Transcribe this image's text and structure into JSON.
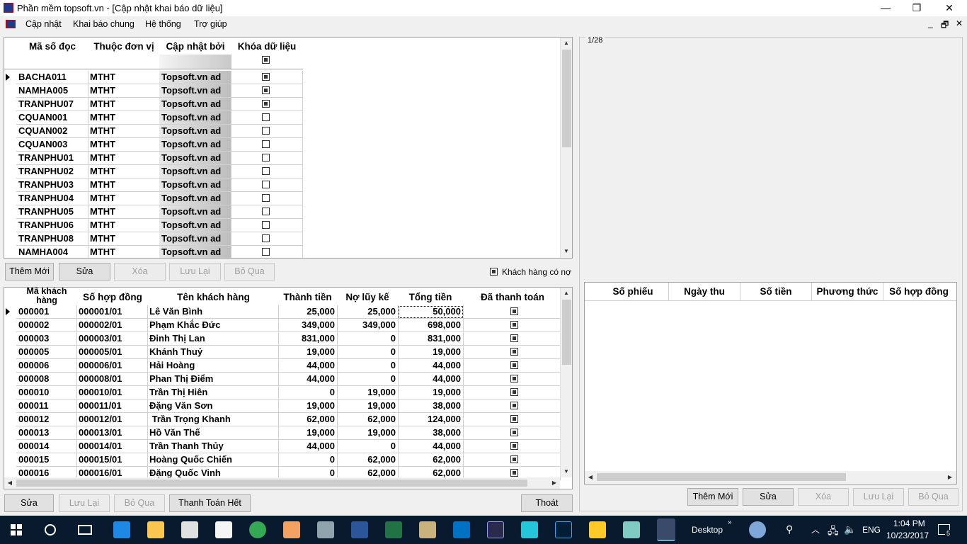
{
  "window": {
    "title": "Phần mềm topsoft.vn - [Cập nhật khai báo dữ liệu]",
    "controls": [
      "—",
      "❐",
      "✕"
    ]
  },
  "menu": {
    "items": [
      "Cập nhật",
      "Khai báo chung",
      "Hệ thống",
      "Trợ giúp"
    ],
    "mdi_controls": [
      "_",
      "🗗",
      "✕"
    ]
  },
  "readers_grid": {
    "columns": [
      "Mã số đọc",
      "Thuộc đơn vị",
      "Cập nhật bởi",
      "Khóa dữ liệu"
    ],
    "header_lock_checked": true,
    "rows": [
      {
        "code": "BACHA011",
        "unit": "MTHT",
        "by": "Topsoft.vn ad",
        "locked": true
      },
      {
        "code": "NAMHA005",
        "unit": "MTHT",
        "by": "Topsoft.vn ad",
        "locked": true
      },
      {
        "code": "TRANPHU07",
        "unit": "MTHT",
        "by": "Topsoft.vn ad",
        "locked": true
      },
      {
        "code": "CQUAN001",
        "unit": "MTHT",
        "by": "Topsoft.vn ad",
        "locked": false
      },
      {
        "code": "CQUAN002",
        "unit": "MTHT",
        "by": "Topsoft.vn ad",
        "locked": false
      },
      {
        "code": "CQUAN003",
        "unit": "MTHT",
        "by": "Topsoft.vn ad",
        "locked": false
      },
      {
        "code": "TRANPHU01",
        "unit": "MTHT",
        "by": "Topsoft.vn ad",
        "locked": false
      },
      {
        "code": "TRANPHU02",
        "unit": "MTHT",
        "by": "Topsoft.vn ad",
        "locked": false
      },
      {
        "code": "TRANPHU03",
        "unit": "MTHT",
        "by": "Topsoft.vn ad",
        "locked": false
      },
      {
        "code": "TRANPHU04",
        "unit": "MTHT",
        "by": "Topsoft.vn ad",
        "locked": false
      },
      {
        "code": "TRANPHU05",
        "unit": "MTHT",
        "by": "Topsoft.vn ad",
        "locked": false
      },
      {
        "code": "TRANPHU06",
        "unit": "MTHT",
        "by": "Topsoft.vn ad",
        "locked": false
      },
      {
        "code": "TRANPHU08",
        "unit": "MTHT",
        "by": "Topsoft.vn ad",
        "locked": false
      },
      {
        "code": "NAMHA004",
        "unit": "MTHT",
        "by": "Topsoft.vn ad",
        "locked": false
      }
    ]
  },
  "top_buttons": {
    "add": "Thêm Mới",
    "edit": "Sửa",
    "delete": "Xóa",
    "save": "Lưu Lại",
    "cancel": "Bỏ Qua"
  },
  "debt_filter": {
    "label": "Khách hàng có nợ",
    "checked": true
  },
  "customers_grid": {
    "columns": [
      "Mã khách hàng",
      "Số hợp đồng",
      "Tên khách hàng",
      "Thành tiền",
      "Nợ lũy kế",
      "Tổng tiền",
      "Đã thanh toán"
    ],
    "rows": [
      {
        "id": "000001",
        "contract": "000001/01",
        "name": "Lê Văn Bình",
        "amount": "25,000",
        "debt": "25,000",
        "total": "50,000",
        "paid": true
      },
      {
        "id": "000002",
        "contract": "000002/01",
        "name": "Phạm Khắc Đức",
        "amount": "349,000",
        "debt": "349,000",
        "total": "698,000",
        "paid": true
      },
      {
        "id": "000003",
        "contract": "000003/01",
        "name": "Đinh Thị Lan",
        "amount": "831,000",
        "debt": "0",
        "total": "831,000",
        "paid": true
      },
      {
        "id": "000005",
        "contract": "000005/01",
        "name": "Khánh Thuỷ",
        "amount": "19,000",
        "debt": "0",
        "total": "19,000",
        "paid": true
      },
      {
        "id": "000006",
        "contract": "000006/01",
        "name": "Hải Hoàng",
        "amount": "44,000",
        "debt": "0",
        "total": "44,000",
        "paid": true
      },
      {
        "id": "000008",
        "contract": "000008/01",
        "name": "Phan Thị Điểm",
        "amount": "44,000",
        "debt": "0",
        "total": "44,000",
        "paid": true
      },
      {
        "id": "000010",
        "contract": "000010/01",
        "name": "Trần Thị Hiên",
        "amount": "0",
        "debt": "19,000",
        "total": "19,000",
        "paid": true
      },
      {
        "id": "000011",
        "contract": "000011/01",
        "name": "Đặng Văn Sơn",
        "amount": "19,000",
        "debt": "19,000",
        "total": "38,000",
        "paid": true
      },
      {
        "id": "000012",
        "contract": "000012/01",
        "name": " Trần Trọng Khanh",
        "amount": "62,000",
        "debt": "62,000",
        "total": "124,000",
        "paid": true
      },
      {
        "id": "000013",
        "contract": "000013/01",
        "name": "Hồ Văn Thế",
        "amount": "19,000",
        "debt": "19,000",
        "total": "38,000",
        "paid": true
      },
      {
        "id": "000014",
        "contract": "000014/01",
        "name": "Trần Thanh Thủy",
        "amount": "44,000",
        "debt": "0",
        "total": "44,000",
        "paid": true
      },
      {
        "id": "000015",
        "contract": "000015/01",
        "name": "Hoàng Quốc Chiến",
        "amount": "0",
        "debt": "62,000",
        "total": "62,000",
        "paid": true
      },
      {
        "id": "000016",
        "contract": "000016/01",
        "name": "Đặng Quốc Vinh",
        "amount": "0",
        "debt": "62,000",
        "total": "62,000",
        "paid": true
      }
    ]
  },
  "bottom_buttons": {
    "edit": "Sửa",
    "save": "Lưu Lại",
    "cancel": "Bỏ Qua",
    "pay_all": "Thanh Toán Hết",
    "exit": "Thoát"
  },
  "preview": {
    "page": "1/28"
  },
  "receipts_grid": {
    "columns": [
      "Số phiếu",
      "Ngày thu",
      "Số tiền",
      "Phương thức",
      "Số hợp đồng"
    ]
  },
  "right_buttons": {
    "add": "Thêm Mới",
    "edit": "Sửa",
    "delete": "Xóa",
    "save": "Lưu Lại",
    "cancel": "Bỏ Qua"
  },
  "taskbar": {
    "desktop_label": "Desktop",
    "language": "ENG",
    "time": "1:04 PM",
    "date": "10/23/2017",
    "notifications": "5"
  }
}
